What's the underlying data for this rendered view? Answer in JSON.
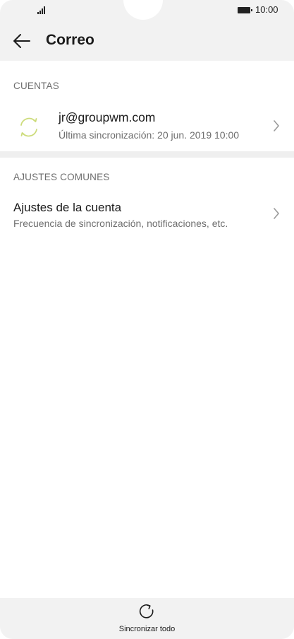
{
  "status_bar": {
    "time": "10:00",
    "signal_icon": "signal-icon",
    "battery_icon": "battery-icon"
  },
  "app_bar": {
    "title": "Correo",
    "back_icon": "back-arrow-icon"
  },
  "sections": {
    "accounts_header": "CUENTAS",
    "common_settings_header": "AJUSTES COMUNES"
  },
  "account": {
    "email": "jr@groupwm.com",
    "last_sync": "Última sincronización: 20 jun. 2019 10:00",
    "icon": "sync-icon",
    "icon_color": "#cddc7c"
  },
  "account_settings": {
    "title": "Ajustes de la cuenta",
    "subtitle": "Frecuencia de sincronización, notificaciones, etc."
  },
  "bottom_bar": {
    "sync_all_label": "Sincronizar todo",
    "icon": "refresh-icon"
  }
}
